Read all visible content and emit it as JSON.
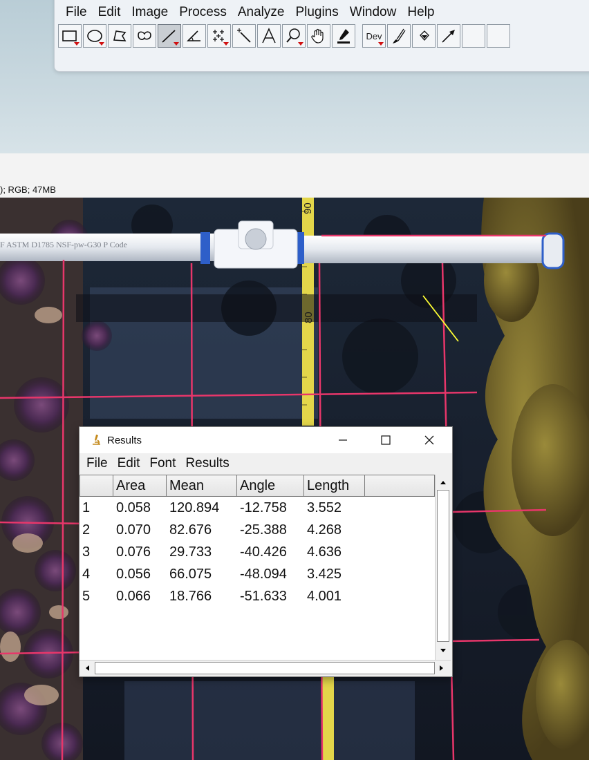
{
  "ij_window": {
    "menu": [
      "File",
      "Edit",
      "Image",
      "Process",
      "Analyze",
      "Plugins",
      "Window",
      "Help"
    ],
    "tools": [
      {
        "name": "rectangle-tool-icon",
        "has_menu": true,
        "active": false
      },
      {
        "name": "oval-tool-icon",
        "has_menu": true,
        "active": false
      },
      {
        "name": "polygon-tool-icon",
        "has_menu": false,
        "active": false
      },
      {
        "name": "freehand-tool-icon",
        "has_menu": false,
        "active": false
      },
      {
        "name": "straight-line-tool-icon",
        "has_menu": true,
        "active": true
      },
      {
        "name": "angle-tool-icon",
        "has_menu": false,
        "active": false
      },
      {
        "name": "multi-point-tool-icon",
        "has_menu": true,
        "active": false
      },
      {
        "name": "wand-tool-icon",
        "has_menu": false,
        "active": false
      },
      {
        "name": "text-tool-icon",
        "has_menu": false,
        "active": false
      },
      {
        "name": "magnifier-tool-icon",
        "has_menu": true,
        "active": false
      },
      {
        "name": "hand-tool-icon",
        "has_menu": false,
        "active": false
      },
      {
        "name": "color-picker-tool-icon",
        "has_menu": false,
        "active": false
      },
      {
        "name": "dev-menu-tool-icon",
        "has_menu": true,
        "active": false,
        "label": "Dev"
      },
      {
        "name": "brush-tool-icon",
        "has_menu": false,
        "active": false
      },
      {
        "name": "flood-fill-tool-icon",
        "has_menu": false,
        "active": false
      },
      {
        "name": "arrow-tool-icon",
        "has_menu": false,
        "active": false
      },
      {
        "name": "empty-slot",
        "has_menu": false,
        "active": false
      },
      {
        "name": "empty-slot",
        "has_menu": false,
        "active": false
      }
    ]
  },
  "image_window": {
    "caption": "); RGB; 47MB",
    "tape_labels": [
      "90",
      "80"
    ],
    "pipe_text": "F ASTM D1785 NSF-pw-G30 P  Code"
  },
  "results_window": {
    "title": "Results",
    "menu": [
      "File",
      "Edit",
      "Font",
      "Results"
    ],
    "columns": [
      "",
      "Area",
      "Mean",
      "Angle",
      "Length",
      ""
    ],
    "rows": [
      [
        "1",
        "0.058",
        "120.894",
        "-12.758",
        "3.552"
      ],
      [
        "2",
        "0.070",
        "82.676",
        "-25.388",
        "4.268"
      ],
      [
        "3",
        "0.076",
        "29.733",
        "-40.426",
        "4.636"
      ],
      [
        "4",
        "0.056",
        "66.075",
        "-48.094",
        "3.425"
      ],
      [
        "5",
        "0.066",
        "18.766",
        "-51.633",
        "4.001"
      ]
    ]
  },
  "colors": {
    "grid_line": "#e8366a",
    "tape_yellow": "#e3d64a",
    "measure_line": "#ffff33"
  }
}
